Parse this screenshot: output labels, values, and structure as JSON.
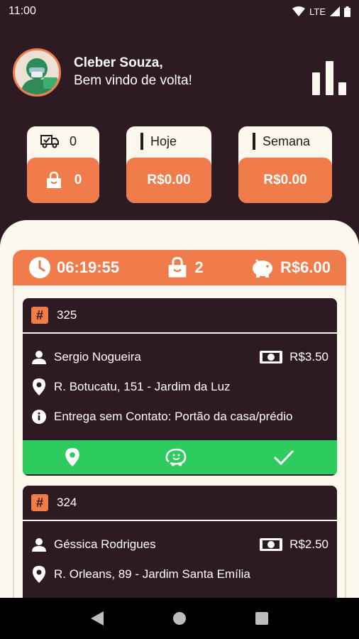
{
  "status_bar": {
    "time": "11:00",
    "network": "LTE"
  },
  "header": {
    "name": "Cleber Souza,",
    "subtitle": "Bem vindo de volta!"
  },
  "summary": [
    {
      "top_label": "0",
      "bottom_value": "0"
    },
    {
      "top_label": "Hoje",
      "bottom_value": "R$0.00"
    },
    {
      "top_label": "Semana",
      "bottom_value": "R$0.00"
    }
  ],
  "route": {
    "time": "06:19:55",
    "orders": "2",
    "total": "R$6.00"
  },
  "orders": [
    {
      "number": "325",
      "customer": "Sergio Nogueira",
      "fee": "R$3.50",
      "address": "R. Botucatu, 151 - Jardim da Luz",
      "note": "Entrega sem Contato: Portão da casa/prédio"
    },
    {
      "number": "324",
      "customer": "Géssica Rodrigues",
      "fee": "R$2.50",
      "address": "R. Orleans, 89 - Jardim Santa Emília"
    }
  ],
  "colors": {
    "background": "#2e1a23",
    "accent": "#f07b4b",
    "cream": "#fcf8ed",
    "green": "#2ecc5f"
  }
}
